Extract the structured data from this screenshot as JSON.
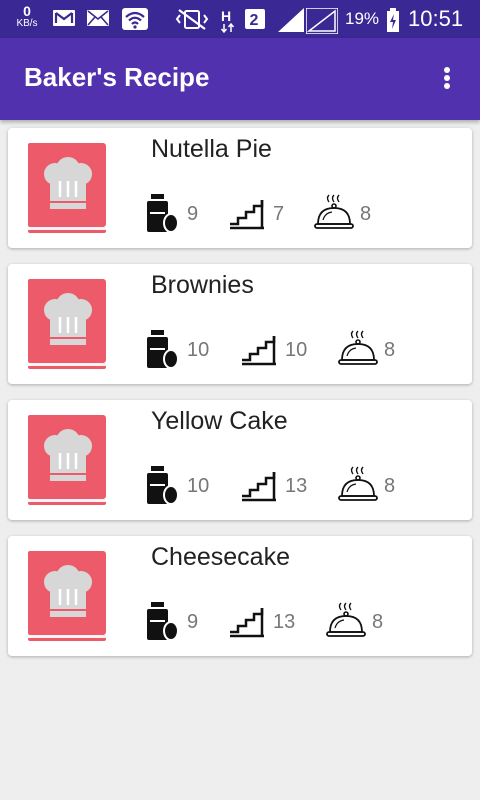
{
  "status_bar": {
    "speed_value": "0",
    "speed_unit": "KB/s",
    "network_type": "H",
    "sim_slot": "2",
    "battery_percent": "19%",
    "time": "10:51"
  },
  "app_bar": {
    "title": "Baker's Recipe",
    "menu_icon": "overflow-menu-icon"
  },
  "colors": {
    "status_bar": "#3a2894",
    "app_bar": "#5131ad",
    "thumbnail": "#ed5a6a",
    "background": "#eeeeee"
  },
  "recipes": [
    {
      "name": "Nutella Pie",
      "ingredients": "9",
      "steps": "7",
      "servings": "8"
    },
    {
      "name": "Brownies",
      "ingredients": "10",
      "steps": "10",
      "servings": "8"
    },
    {
      "name": "Yellow Cake",
      "ingredients": "10",
      "steps": "13",
      "servings": "8"
    },
    {
      "name": "Cheesecake",
      "ingredients": "9",
      "steps": "13",
      "servings": "8"
    }
  ]
}
